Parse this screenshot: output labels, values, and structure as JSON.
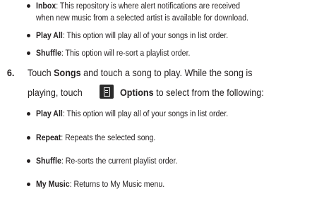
{
  "section1": {
    "bullets": [
      {
        "term": "Inbox",
        "sep": ": ",
        "text": "This repository is where alert notifications are received",
        "cont": "when new music from a selected artist is available for download."
      },
      {
        "term": "Play All",
        "sep": ": ",
        "text": "This option will play all of your songs in list order."
      },
      {
        "term": "Shuffle",
        "sep": ": ",
        "text": "This option will re-sort a playlist order."
      }
    ]
  },
  "step": {
    "number": "6.",
    "line1_a": "Touch ",
    "line1_b": "Songs",
    "line1_c": " and touch a song to play. While the song is",
    "line2_a": "playing, touch",
    "line2_icon": "options-menu-icon",
    "line2_b": "Options",
    "line2_c": " to select from the following:"
  },
  "section2": {
    "bullets": [
      {
        "term": "Play All",
        "sep": ": ",
        "text": "This option will play all of your songs in list order."
      },
      {
        "term": "Repeat",
        "sep": ": ",
        "text": "Repeats the selected song."
      },
      {
        "term": "Shuffle",
        "sep": ": ",
        "text": "Re-sorts the current playlist order."
      },
      {
        "term": "My Music",
        "sep": ": ",
        "text": "Returns to My Music menu."
      }
    ]
  }
}
